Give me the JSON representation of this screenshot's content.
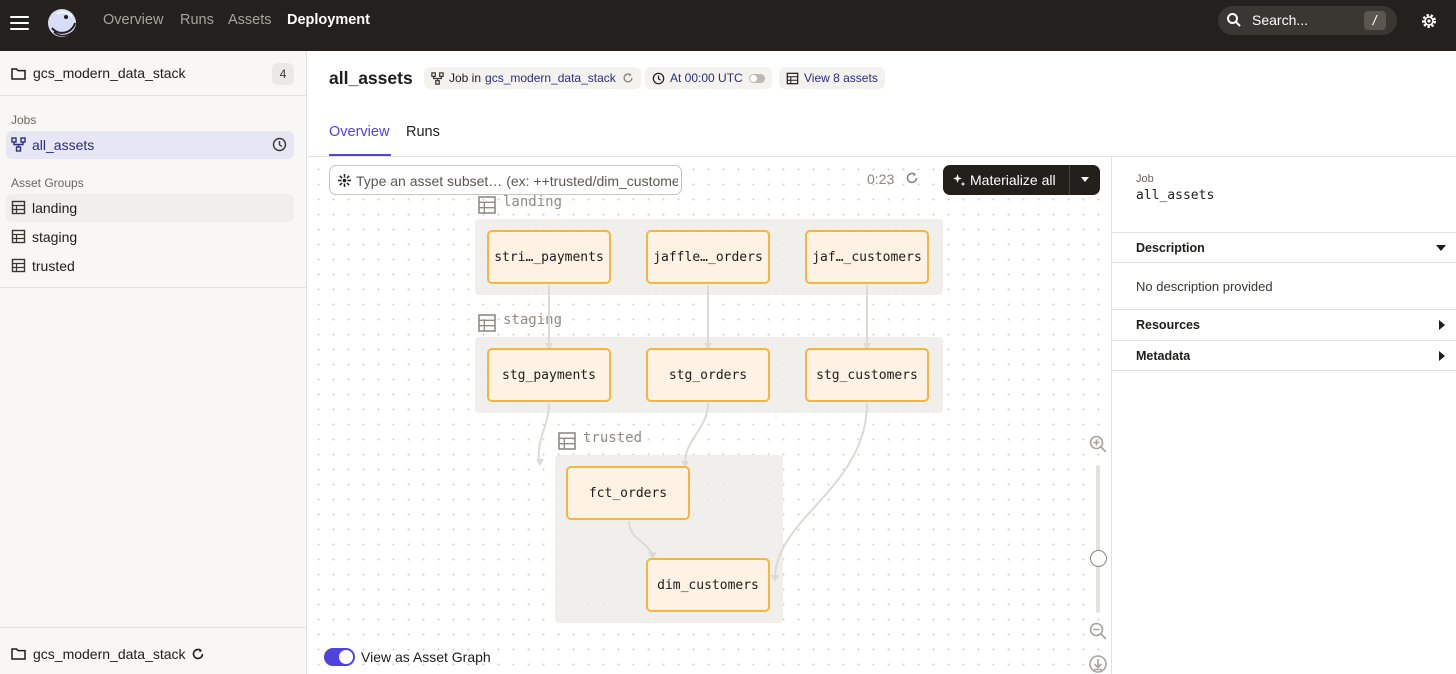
{
  "topbar": {
    "nav": [
      "Overview",
      "Runs",
      "Assets",
      "Deployment"
    ],
    "search_label": "Search...",
    "search_shortcut": "/"
  },
  "sidebar": {
    "repo_name": "gcs_modern_data_stack",
    "repo_count": "4",
    "jobs_label": "Jobs",
    "job_item": "all_assets",
    "asset_groups_label": "Asset Groups",
    "asset_groups": [
      "landing",
      "staging",
      "trusted"
    ],
    "footer_repo": "gcs_modern_data_stack"
  },
  "header": {
    "title": "all_assets",
    "job_tag_prefix": "Job in",
    "job_tag_repo": "gcs_modern_data_stack",
    "schedule_tag": "At 00:00 UTC",
    "view_assets_tag": "View 8 assets",
    "tabs": [
      "Overview",
      "Runs"
    ]
  },
  "graph": {
    "subset_placeholder": "Type an asset subset… (ex: ++trusted/dim_customers+)",
    "timer": "0:23",
    "materialize_label": "Materialize all",
    "groups": [
      "landing",
      "staging",
      "trusted"
    ],
    "nodes": {
      "landing": [
        "stri…_payments",
        "jaffle…_orders",
        "jaf…_customers"
      ],
      "staging": [
        "stg_payments",
        "stg_orders",
        "stg_customers"
      ],
      "trusted": [
        "fct_orders",
        "dim_customers"
      ]
    },
    "toggle_label": "View as Asset Graph",
    "toggle_on": true
  },
  "right_panel": {
    "job_label": "Job",
    "job_name": "all_assets",
    "description_title": "Description",
    "description_text": "No description provided",
    "resources_title": "Resources",
    "metadata_title": "Metadata"
  },
  "colors": {
    "accent": "#4f43dd",
    "topbar": "#23201d",
    "node_fill": "#fdf2e3",
    "node_border": "#f4b63e"
  }
}
